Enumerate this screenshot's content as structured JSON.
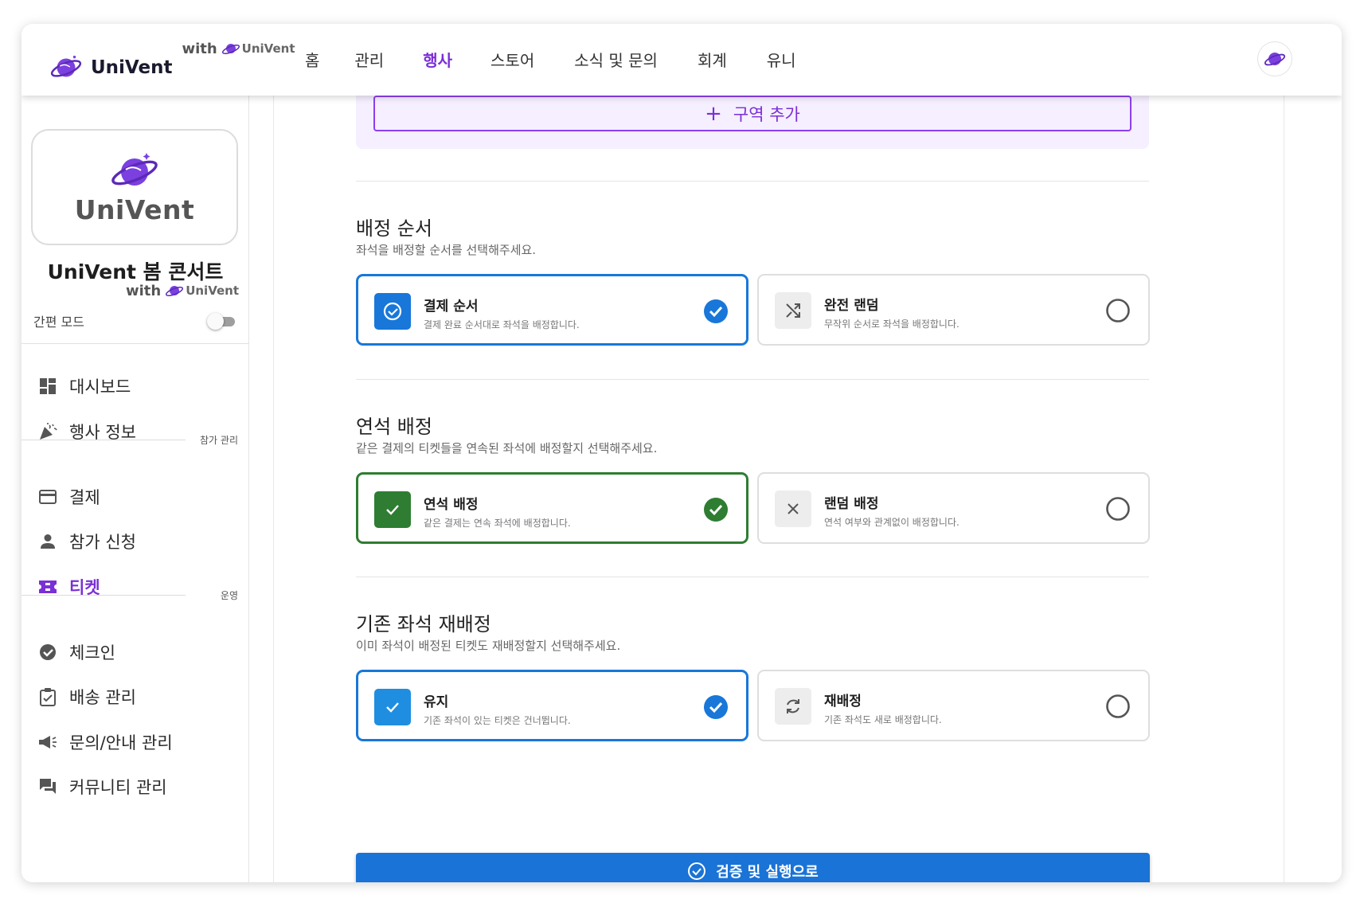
{
  "brand": {
    "name": "UniVent",
    "with": "with",
    "univent_small": "UniVent"
  },
  "nav": {
    "items": [
      "홈",
      "관리",
      "행사",
      "스토어",
      "소식 및 문의",
      "회계",
      "유니"
    ],
    "active_index": 2
  },
  "sidebar": {
    "logo_word": "UniVent",
    "event_name": "UniVent 봄 콘서트",
    "with": "with",
    "univent_small": "UniVent",
    "mode_label": "간편 모드",
    "mode_on": false,
    "items_top": [
      {
        "label": "대시보드",
        "icon": "dashboard-icon"
      },
      {
        "label": "행사 정보",
        "icon": "celebration-icon"
      }
    ],
    "section_participation": "참가 관리",
    "items_participation": [
      {
        "label": "결제",
        "icon": "credit-card-icon"
      },
      {
        "label": "참가 신청",
        "icon": "person-icon"
      },
      {
        "label": "티켓",
        "icon": "ticket-icon",
        "active": true
      }
    ],
    "section_operation": "운영",
    "items_operation": [
      {
        "label": "체크인",
        "icon": "check-circle-icon"
      },
      {
        "label": "배송 관리",
        "icon": "clipboard-icon"
      },
      {
        "label": "문의/안내 관리",
        "icon": "megaphone-icon"
      },
      {
        "label": "커뮤니티 관리",
        "icon": "forum-icon"
      }
    ]
  },
  "main": {
    "add_seat_label": "구역 추가",
    "order": {
      "title": "배정 순서",
      "desc": "좌석을 배정할 순서를 선택해주세요.",
      "options": [
        {
          "name": "결제 순서",
          "sub": "결제 완료 순서대로 좌석을 배정합니다.",
          "selected": true
        },
        {
          "name": "완전 랜덤",
          "sub": "무작위 순서로 좌석을 배정합니다.",
          "selected": false
        }
      ]
    },
    "contiguous": {
      "title": "연석 배정",
      "desc": "같은 결제의 티켓들을 연속된 좌석에 배정할지 선택해주세요.",
      "options": [
        {
          "name": "연석 배정",
          "sub": "같은 결제는 연속 좌석에 배정합니다.",
          "selected": true
        },
        {
          "name": "랜덤 배정",
          "sub": "연석 여부와 관계없이 배정합니다.",
          "selected": false
        }
      ]
    },
    "reassign": {
      "title": "기존 좌석 재배정",
      "desc": "이미 좌석이 배정된 티켓도 재배정할지 선택해주세요.",
      "options": [
        {
          "name": "유지",
          "sub": "기존 좌석이 있는 티켓은 건너뜁니다.",
          "selected": true
        },
        {
          "name": "재배정",
          "sub": "기존 좌석도 새로 배정합니다.",
          "selected": false
        }
      ]
    },
    "submit_label": "검증 및 실행으로"
  },
  "colors": {
    "accent": "#7b2fd6",
    "primary": "#1a73d6",
    "green": "#2e7d32",
    "blue_select": "#1877d9"
  }
}
